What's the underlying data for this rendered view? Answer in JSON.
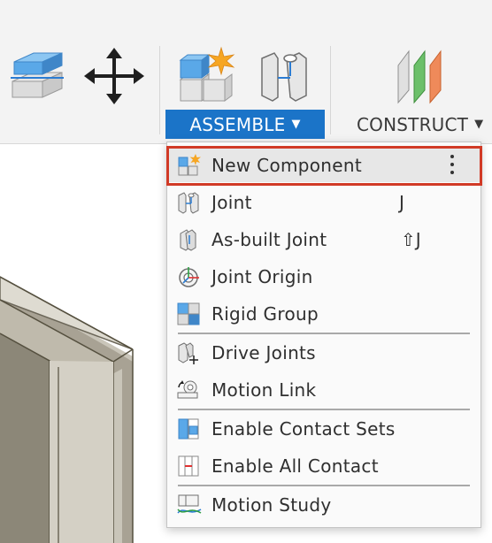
{
  "toolbar": {
    "tools": [
      {
        "name": "extrude-icon"
      },
      {
        "name": "move-copy-icon"
      },
      {
        "name": "new-component-icon"
      },
      {
        "name": "joint-icon"
      },
      {
        "name": "construct-plane-icon"
      }
    ],
    "assemble_label": "ASSEMBLE",
    "construct_label": "CONSTRUCT",
    "active_tab_color": "#1b74c8"
  },
  "menu": {
    "items": [
      {
        "label": "New Component",
        "icon": "new-component-icon",
        "shortcut": "",
        "highlighted": true,
        "more_icon": "more-options-icon"
      },
      {
        "label": "Joint",
        "icon": "joint-icon",
        "shortcut": "J"
      },
      {
        "label": "As-built Joint",
        "icon": "as-built-joint-icon",
        "shortcut": "⇧J"
      },
      {
        "label": "Joint Origin",
        "icon": "joint-origin-icon",
        "shortcut": ""
      },
      {
        "label": "Rigid Group",
        "icon": "rigid-group-icon",
        "shortcut": ""
      },
      {
        "label": "Drive Joints",
        "icon": "drive-joints-icon",
        "shortcut": ""
      },
      {
        "label": "Motion Link",
        "icon": "motion-link-icon",
        "shortcut": ""
      },
      {
        "label": "Enable Contact Sets",
        "icon": "enable-contact-sets-icon",
        "shortcut": ""
      },
      {
        "label": "Enable All Contact",
        "icon": "enable-all-contact-icon",
        "shortcut": ""
      },
      {
        "label": "Motion Study",
        "icon": "motion-study-icon",
        "shortcut": ""
      }
    ],
    "highlight_color": "#d13a26"
  }
}
